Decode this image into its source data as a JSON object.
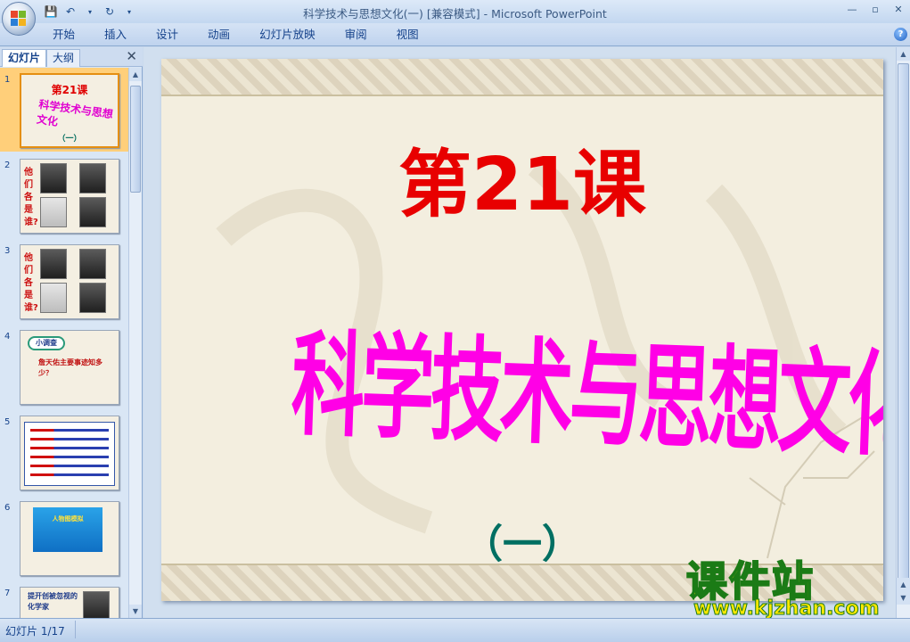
{
  "window": {
    "title": "科学技术与思想文化(一) [兼容模式] - Microsoft PowerPoint",
    "controls": [
      "—",
      "▫",
      "✕"
    ]
  },
  "ribbon": {
    "tabs": [
      "开始",
      "插入",
      "设计",
      "动画",
      "幻灯片放映",
      "审阅",
      "视图"
    ],
    "help": "?"
  },
  "panel": {
    "tabs": [
      "幻灯片",
      "大纲"
    ],
    "close": "✕",
    "thumbnails": [
      {
        "num": "1",
        "title": "第21课",
        "subtitle": "科学技术与思想文化",
        "sub2": "（一）"
      },
      {
        "num": "2",
        "side": "他们各是谁?"
      },
      {
        "num": "3",
        "side": "他们各是谁?"
      },
      {
        "num": "4",
        "badge": "小调查",
        "text": "詹天佑主要事迹知多少？"
      },
      {
        "num": "5"
      },
      {
        "num": "6",
        "blue_text": "人物图模拟"
      },
      {
        "num": "7",
        "text": "提开创被忽视的化学家"
      }
    ]
  },
  "slide": {
    "title": "第21课",
    "subtitle": "科学技术与思想文化",
    "sub2": "（一）"
  },
  "watermark": {
    "main": "课件站",
    "url": "www.kjzhan.com"
  },
  "status": {
    "slide_counter": "幻灯片 1/17"
  }
}
